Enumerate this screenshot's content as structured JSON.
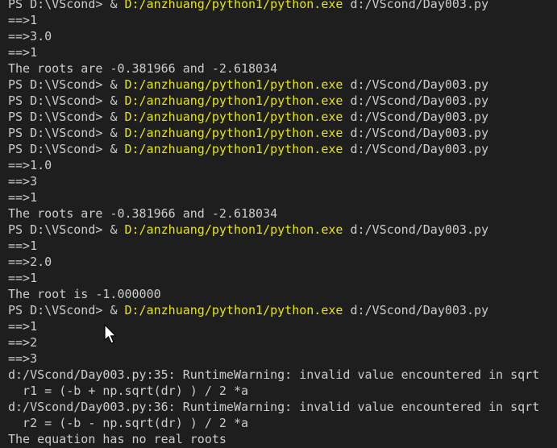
{
  "terminal": {
    "colors": {
      "background": "#1e1e1e",
      "text": "#cccccc",
      "command": "#e5e510"
    },
    "lines": [
      {
        "kind": "prompt",
        "prompt": "PS D:\\VScond>",
        "amp": "&",
        "command": "D:/anzhuang/python1/python.exe",
        "arg": "d:/VScond/Day003.py"
      },
      {
        "kind": "text",
        "text": "==>1"
      },
      {
        "kind": "text",
        "text": "==>3.0"
      },
      {
        "kind": "text",
        "text": "==>1"
      },
      {
        "kind": "text",
        "text": "The roots are -0.381966 and -2.618034"
      },
      {
        "kind": "prompt",
        "prompt": "PS D:\\VScond>",
        "amp": "&",
        "command": "D:/anzhuang/python1/python.exe",
        "arg": "d:/VScond/Day003.py"
      },
      {
        "kind": "prompt",
        "prompt": "PS D:\\VScond>",
        "amp": "&",
        "command": "D:/anzhuang/python1/python.exe",
        "arg": "d:/VScond/Day003.py"
      },
      {
        "kind": "prompt",
        "prompt": "PS D:\\VScond>",
        "amp": "&",
        "command": "D:/anzhuang/python1/python.exe",
        "arg": "d:/VScond/Day003.py"
      },
      {
        "kind": "prompt",
        "prompt": "PS D:\\VScond>",
        "amp": "&",
        "command": "D:/anzhuang/python1/python.exe",
        "arg": "d:/VScond/Day003.py"
      },
      {
        "kind": "prompt",
        "prompt": "PS D:\\VScond>",
        "amp": "&",
        "command": "D:/anzhuang/python1/python.exe",
        "arg": "d:/VScond/Day003.py"
      },
      {
        "kind": "text",
        "text": "==>1.0"
      },
      {
        "kind": "text",
        "text": "==>3"
      },
      {
        "kind": "text",
        "text": "==>1"
      },
      {
        "kind": "text",
        "text": "The roots are -0.381966 and -2.618034"
      },
      {
        "kind": "prompt",
        "prompt": "PS D:\\VScond>",
        "amp": "&",
        "command": "D:/anzhuang/python1/python.exe",
        "arg": "d:/VScond/Day003.py"
      },
      {
        "kind": "text",
        "text": "==>1"
      },
      {
        "kind": "text",
        "text": "==>2.0"
      },
      {
        "kind": "text",
        "text": "==>1"
      },
      {
        "kind": "text",
        "text": "The root is -1.000000"
      },
      {
        "kind": "prompt",
        "prompt": "PS D:\\VScond>",
        "amp": "&",
        "command": "D:/anzhuang/python1/python.exe",
        "arg": "d:/VScond/Day003.py"
      },
      {
        "kind": "text",
        "text": "==>1"
      },
      {
        "kind": "text",
        "text": "==>2"
      },
      {
        "kind": "text",
        "text": "==>3"
      },
      {
        "kind": "text",
        "text": "d:/VScond/Day003.py:35: RuntimeWarning: invalid value encountered in sqrt"
      },
      {
        "kind": "text",
        "text": "  r1 = (-b + np.sqrt(dr) ) / 2 *a"
      },
      {
        "kind": "text",
        "text": "d:/VScond/Day003.py:36: RuntimeWarning: invalid value encountered in sqrt"
      },
      {
        "kind": "text",
        "text": "  r2 = (-b - np.sqrt(dr) ) / 2 *a"
      },
      {
        "kind": "text",
        "text": "The equation has no real roots"
      }
    ]
  }
}
